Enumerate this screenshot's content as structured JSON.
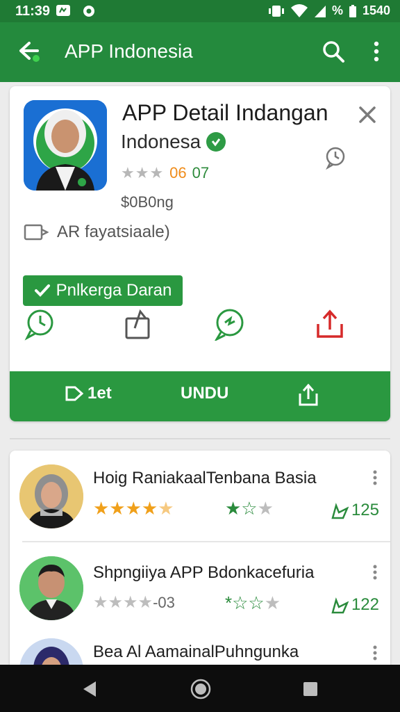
{
  "status_bar": {
    "time": "11:39",
    "right_text": "%",
    "battery_text": "1540"
  },
  "app_bar": {
    "title": "APP Indonesia"
  },
  "detail": {
    "title": "APP Detail Indangan",
    "developer": "Indonesa",
    "rating_a": "06",
    "rating_b": "07",
    "price": "$0B0ng",
    "availability": "AR fayatsiaale)",
    "primary_button": "Pnlkerga Daran",
    "bottom_left": "1et",
    "bottom_center": "UNDU"
  },
  "list": [
    {
      "title": "Hoig RaniakaalTenbana Basia",
      "count": "125"
    },
    {
      "title": "Shpngiiya APP Bdonkacefuria",
      "rating_text": "-03",
      "count": "122"
    },
    {
      "title": "Bea Al AamainalPuhngunka"
    }
  ],
  "colors": {
    "primary": "#248a3d",
    "primary_dark": "#1f7a34",
    "star_orange": "#f08c1a",
    "red_icon": "#d62a2a"
  }
}
